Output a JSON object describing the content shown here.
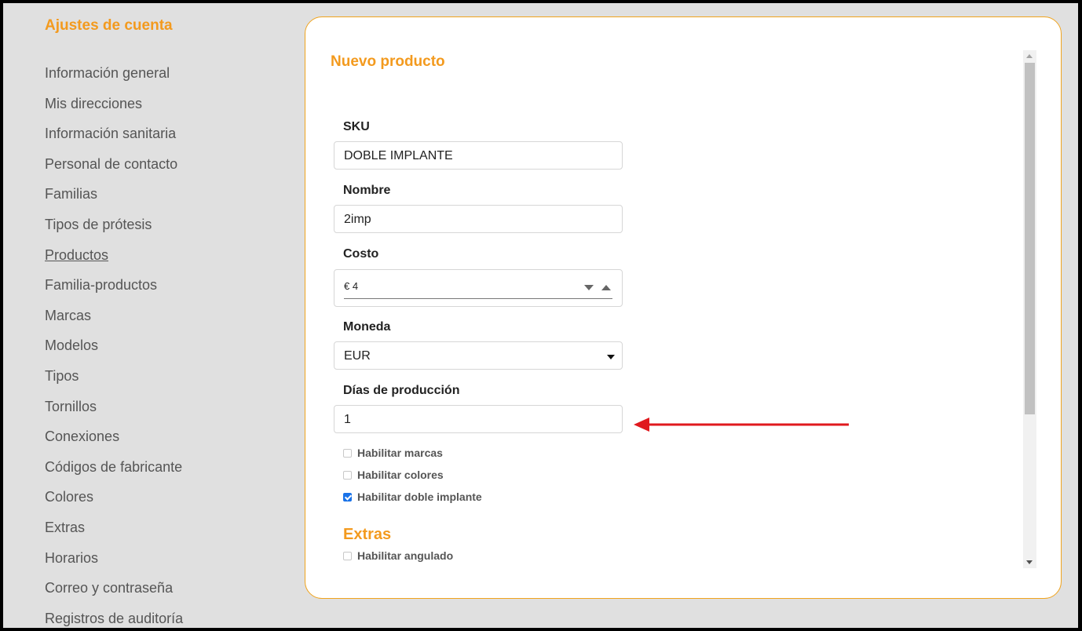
{
  "sidebar": {
    "title": "Ajustes de cuenta",
    "items": [
      {
        "label": "Información general"
      },
      {
        "label": "Mis direcciones"
      },
      {
        "label": "Información sanitaria"
      },
      {
        "label": "Personal de contacto"
      },
      {
        "label": "Familias"
      },
      {
        "label": "Tipos de prótesis"
      },
      {
        "label": "Productos",
        "active": true
      },
      {
        "label": "Familia-productos"
      },
      {
        "label": "Marcas"
      },
      {
        "label": "Modelos"
      },
      {
        "label": "Tipos"
      },
      {
        "label": "Tornillos"
      },
      {
        "label": "Conexiones"
      },
      {
        "label": "Códigos de fabricante"
      },
      {
        "label": "Colores"
      },
      {
        "label": "Extras"
      },
      {
        "label": "Horarios"
      },
      {
        "label": "Correo y contraseña"
      },
      {
        "label": "Registros de auditoría"
      }
    ]
  },
  "form": {
    "title": "Nuevo producto",
    "sku": {
      "label": "SKU",
      "value": "DOBLE IMPLANTE"
    },
    "nombre": {
      "label": "Nombre",
      "value": "2imp"
    },
    "costo": {
      "label": "Costo",
      "value": "€ 4"
    },
    "moneda": {
      "label": "Moneda",
      "value": "EUR"
    },
    "dias": {
      "label": "Días de producción",
      "value": "1"
    },
    "checks": [
      {
        "label": "Habilitar marcas",
        "checked": false
      },
      {
        "label": "Habilitar colores",
        "checked": false
      },
      {
        "label": "Habilitar doble implante",
        "checked": true
      }
    ],
    "extras": {
      "title": "Extras",
      "checks": [
        {
          "label": "Habilitar angulado",
          "checked": false
        }
      ]
    }
  },
  "colors": {
    "accent": "#f39a1e",
    "annotation_arrow": "#e0191e",
    "checkbox_checked": "#1a73e8"
  }
}
